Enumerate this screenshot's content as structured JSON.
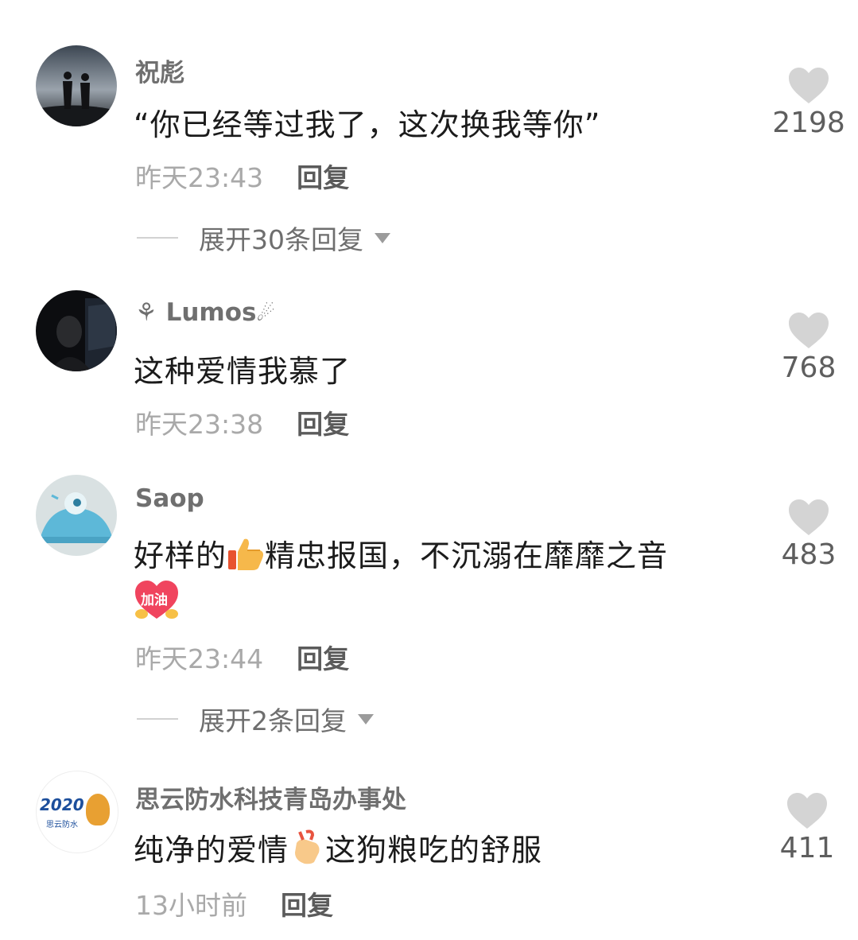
{
  "comments": [
    {
      "username": "祝彪",
      "text": "“你已经等过我了，这次换我等你”",
      "time": "昨天23:43",
      "reply_label": "回复",
      "likes": "2198",
      "expand_label": "展开30条回复"
    },
    {
      "username": "Lumos",
      "text": "这种爱情我慕了",
      "time": "昨天23:38",
      "reply_label": "回复",
      "likes": "768"
    },
    {
      "username": "Saop",
      "text_before": "好样的",
      "text_after": "精忠报国，不沉溺在靡靡之音",
      "emoji_badge": "加油",
      "time": "昨天23:44",
      "reply_label": "回复",
      "likes": "483",
      "expand_label": "展开2条回复"
    },
    {
      "username": "思云防水科技青岛办事处",
      "text_before": "纯净的爱情",
      "text_after": "这狗粮吃的舒服",
      "avatar_text": "2020",
      "avatar_subtext": "思云防水",
      "time": "13小时前",
      "reply_label": "回复",
      "likes": "411"
    }
  ],
  "icons": {
    "like": "heart-icon",
    "expand": "caret-down-icon",
    "thumbs_up": "thumbs-up-emoji",
    "finger_heart": "finger-heart-emoji",
    "jiayou": "jiayou-heart-sticker"
  },
  "colors": {
    "text": "#1b1b1b",
    "username": "#6f6f6f",
    "time": "#a9a9a9",
    "heart": "#d4d4d4"
  }
}
